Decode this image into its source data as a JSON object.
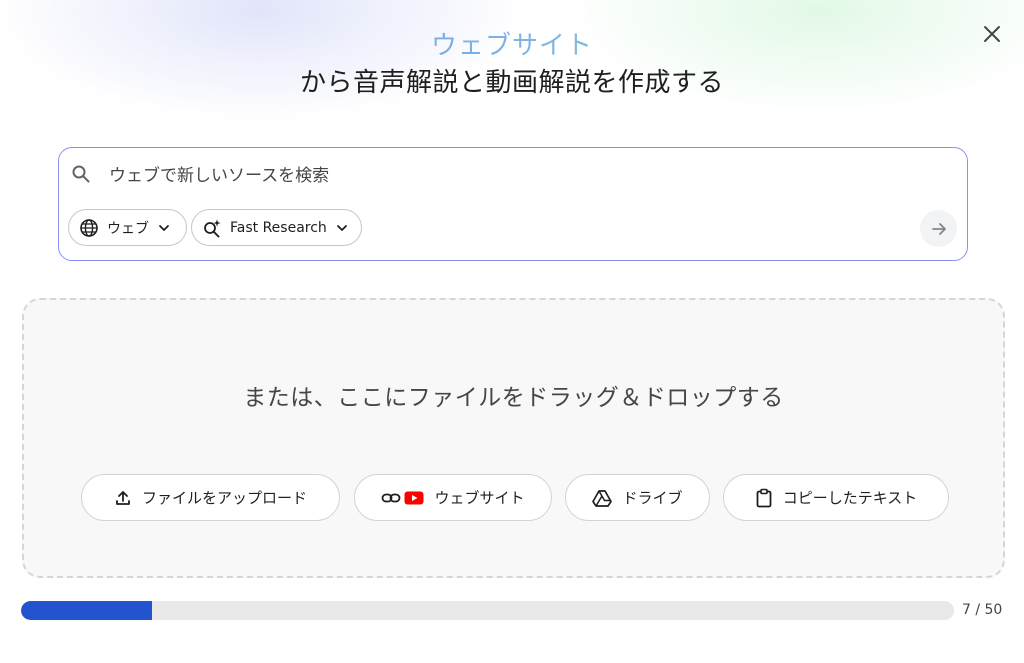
{
  "header": {
    "title_accent": "ウェブサイト",
    "title_main": "から音声解説と動画解説を作成する"
  },
  "search": {
    "placeholder": "ウェブで新しいソースを検索",
    "value": "",
    "source_chip": "ウェブ",
    "mode_chip": "Fast Research"
  },
  "dropzone": {
    "text": "または、ここにファイルをドラッグ＆ドロップする",
    "buttons": {
      "upload": "ファイルをアップロード",
      "website": "ウェブサイト",
      "drive": "ドライブ",
      "copied_text": "コピーしたテキスト"
    }
  },
  "progress": {
    "current": 7,
    "max": 50,
    "label": "7 / 50"
  },
  "colors": {
    "accent": "#2453d0",
    "youtube_red": "#ff0000",
    "search_border": "#8c8ff0"
  },
  "icons": {
    "close": "close-icon",
    "search": "search-icon",
    "globe": "globe-icon",
    "sparkle_search": "sparkle-search-icon",
    "chevron": "chevron-down-icon",
    "arrow": "arrow-right-icon",
    "upload": "upload-icon",
    "link": "link-icon",
    "youtube": "youtube-icon",
    "drive": "drive-icon",
    "clipboard": "clipboard-icon"
  }
}
